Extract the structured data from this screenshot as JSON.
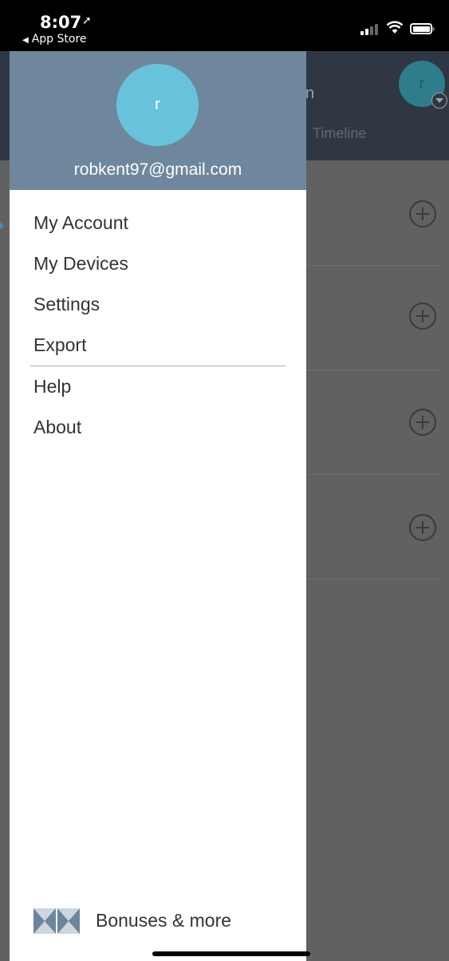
{
  "status_bar": {
    "time": "8:07",
    "back_label": "App Store"
  },
  "background_app": {
    "header_partial_text": "n",
    "tab_label": "Timeline",
    "avatar_letter": "r",
    "row_count": 4
  },
  "drawer": {
    "avatar_letter": "r",
    "email": "robkent97@gmail.com",
    "menu_items": [
      {
        "label": "My Account"
      },
      {
        "label": "My Devices"
      },
      {
        "label": "Settings"
      },
      {
        "label": "Export"
      },
      {
        "label": "Help"
      },
      {
        "label": "About"
      }
    ],
    "bonus_label": "Bonuses & more"
  },
  "colors": {
    "drawer_header": "#6e879d",
    "avatar": "#67c3db",
    "background_dim": "#616161",
    "active_marker": "#3d8bd1"
  }
}
